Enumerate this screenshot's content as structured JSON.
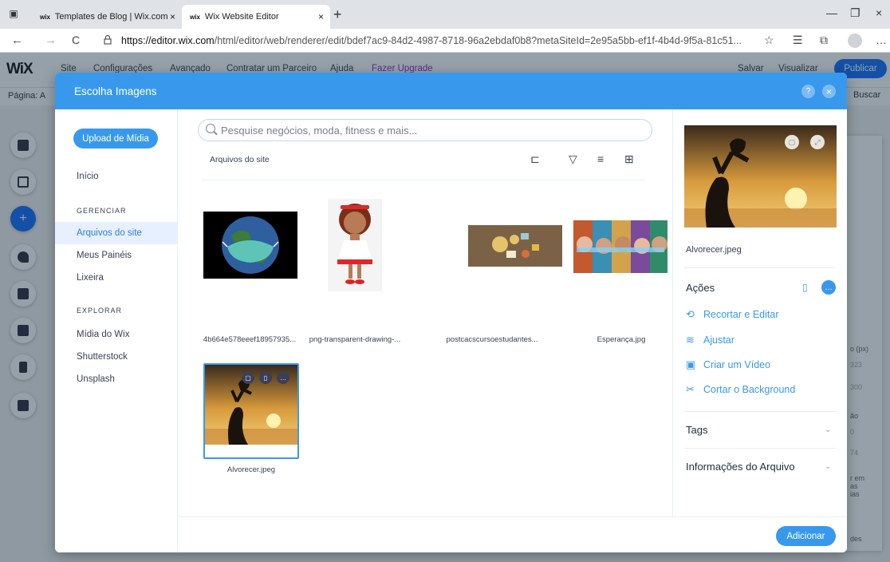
{
  "browser": {
    "tabs": [
      {
        "favicon": "wix",
        "title": "Templates de Blog | Wix.com",
        "close": "×"
      },
      {
        "favicon": "wix",
        "title": "Wix Website Editor",
        "close": "×"
      }
    ],
    "new_tab": "+",
    "window_controls": {
      "minimize": "—",
      "restore": "❐",
      "close": "×"
    },
    "nav": {
      "back": "←",
      "forward": "→",
      "reload": "C"
    },
    "url_host": "https://editor.wix.com",
    "url_rest": "/html/editor/web/renderer/edit/bdef7ac9-84d2-4987-8718-96a2ebdaf0b8?metaSiteId=2e95a5bb-ef1f-4b4d-9f5a-81c51...",
    "toolbar_icons": [
      "☆",
      "☰",
      "⧉",
      "…"
    ]
  },
  "editor": {
    "logo": "WiX",
    "menu": [
      "Site",
      "Configurações",
      "Avançado",
      "Contratar um Parceiro",
      "Ajuda",
      "Fazer Upgrade"
    ],
    "save": "Salvar",
    "preview": "Visualizar",
    "publish": "Publicar",
    "page_label": "Página: A",
    "search": "Buscar",
    "right_panel_bits": [
      "o (px)",
      "323",
      "300",
      "ão",
      "0",
      "74",
      "r em",
      "as",
      "ias",
      "des"
    ]
  },
  "dialog": {
    "title": "Escolha Imagens",
    "help": "?",
    "close": "×",
    "upload_button": "Upload de Mídia",
    "sidebar": {
      "home": "Início",
      "manage_header": "GERENCIAR",
      "manage_items": [
        "Arquivos do site",
        "Meus Painéis",
        "Lixeira"
      ],
      "explore_header": "EXPLORAR",
      "explore_items": [
        "Mídia do Wix",
        "Shutterstock",
        "Unsplash"
      ]
    },
    "search_placeholder": "Pesquise negócios, moda, fitness e mais...",
    "breadcrumb": "Arquivos do site",
    "files": [
      {
        "name": "4b664e578eeef18957935..."
      },
      {
        "name": "png-transparent-drawing-..."
      },
      {
        "name": "postcacscursoestudantes..."
      },
      {
        "name": "Esperança.jpg"
      },
      {
        "name": "Alvorecer.jpeg",
        "selected": true
      }
    ],
    "details": {
      "file_name": "Alvorecer.jpeg",
      "actions_title": "Ações",
      "actions": [
        {
          "icon": "crop-icon",
          "label": "Recortar e Editar"
        },
        {
          "icon": "adjust-icon",
          "label": "Ajustar"
        },
        {
          "icon": "video-icon",
          "label": "Criar um Vídeo"
        },
        {
          "icon": "scissors-icon",
          "label": "Cortar o Background"
        }
      ],
      "tags": "Tags",
      "file_info": "Informações do Arquivo"
    },
    "add_button": "Adicionar"
  },
  "colors": {
    "accent": "#3899ec",
    "publish": "#116dff",
    "upgrade": "#9a27d5",
    "selected_bg": "#e7f0ff"
  }
}
